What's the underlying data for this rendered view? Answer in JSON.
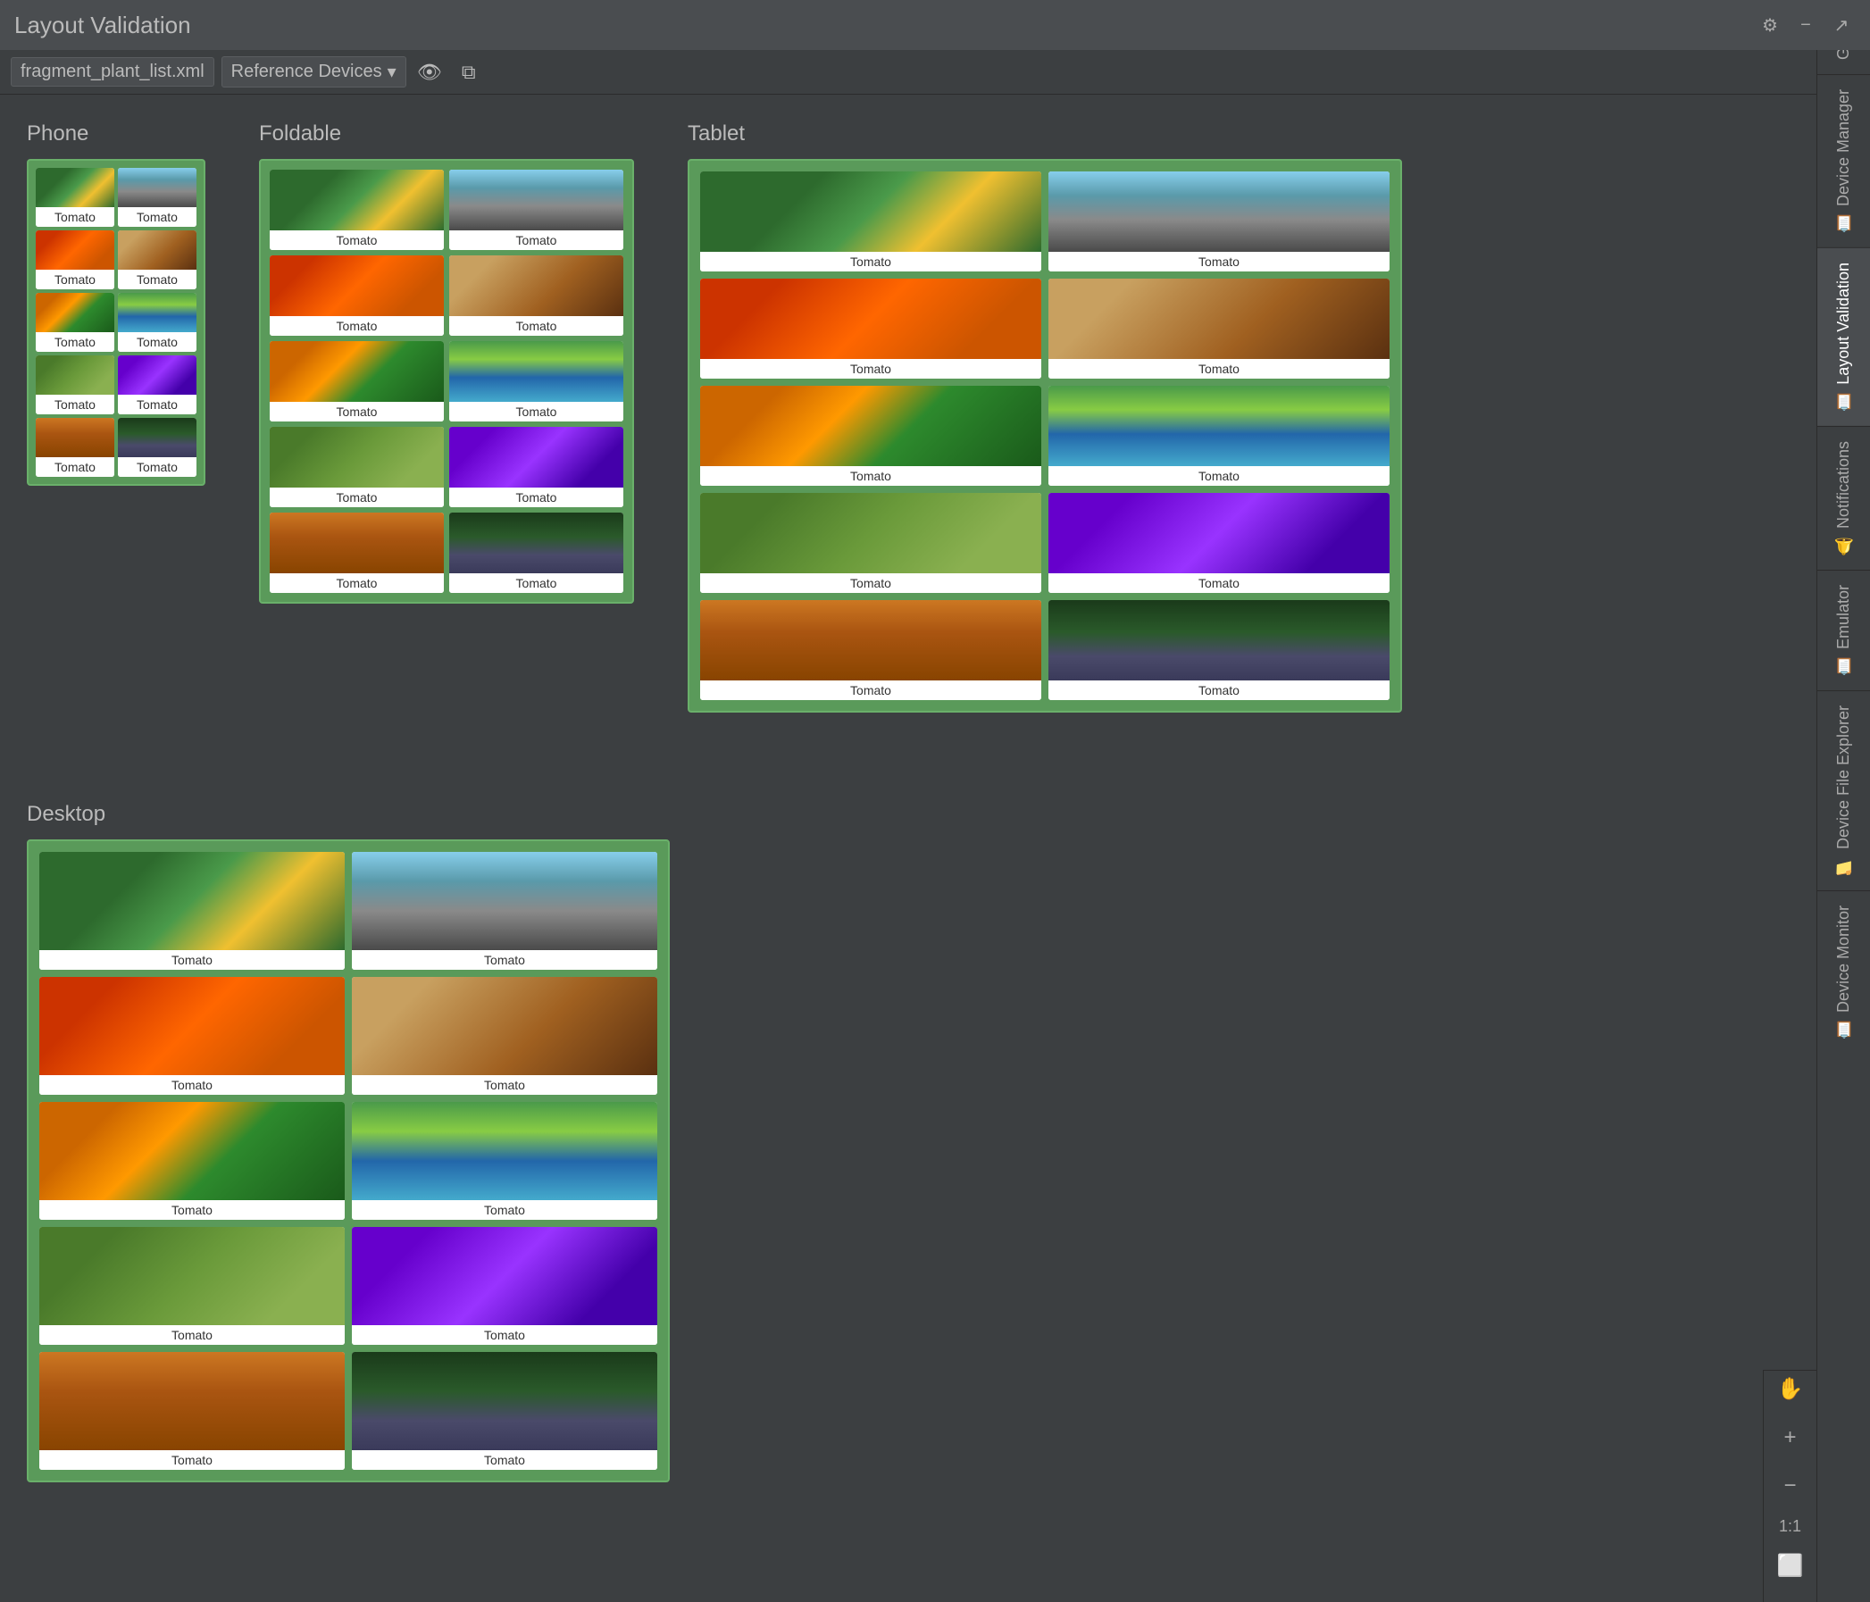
{
  "titleBar": {
    "title": "Layout Validation",
    "gearIcon": "⚙",
    "minusIcon": "−",
    "arrowIcon": "↗"
  },
  "toolbar": {
    "file": "fragment_plant_list.xml",
    "dropdown": "Reference Devices",
    "dropdownIcon": "▾",
    "eyeIcon": "👁",
    "copyIcon": "⧉"
  },
  "rightTabs": [
    {
      "id": "grade",
      "label": "Grade",
      "icon": "≡"
    },
    {
      "id": "device-manager",
      "label": "Device Manager",
      "icon": "📋"
    },
    {
      "id": "layout-validation",
      "label": "Layout Validation",
      "icon": "📋",
      "active": true
    },
    {
      "id": "notifications",
      "label": "Notifications",
      "icon": "🔔"
    },
    {
      "id": "emulator",
      "label": "Emulator",
      "icon": "📋"
    },
    {
      "id": "device-file-explorer",
      "label": "Device File Explorer",
      "icon": "📁"
    },
    {
      "id": "device-monitor",
      "label": "Device Monitor",
      "icon": "📋"
    }
  ],
  "devices": {
    "phone": {
      "title": "Phone",
      "cards": [
        {
          "label": "Tomato",
          "img": "butterfly"
        },
        {
          "label": "Tomato",
          "img": "cityscape"
        },
        {
          "label": "Tomato",
          "img": "autumn"
        },
        {
          "label": "Tomato",
          "img": "macro"
        },
        {
          "label": "Tomato",
          "img": "sunflower"
        },
        {
          "label": "Tomato",
          "img": "coastal"
        },
        {
          "label": "Tomato",
          "img": "vineyard"
        },
        {
          "label": "Tomato",
          "img": "purple"
        },
        {
          "label": "Tomato",
          "img": "desert"
        },
        {
          "label": "Tomato",
          "img": "forest"
        }
      ]
    },
    "foldable": {
      "title": "Foldable",
      "cards": [
        {
          "label": "Tomato",
          "img": "butterfly"
        },
        {
          "label": "Tomato",
          "img": "cityscape"
        },
        {
          "label": "Tomato",
          "img": "autumn"
        },
        {
          "label": "Tomato",
          "img": "macro"
        },
        {
          "label": "Tomato",
          "img": "sunflower"
        },
        {
          "label": "Tomato",
          "img": "coastal"
        },
        {
          "label": "Tomato",
          "img": "vineyard"
        },
        {
          "label": "Tomato",
          "img": "purple"
        },
        {
          "label": "Tomato",
          "img": "desert"
        },
        {
          "label": "Tomato",
          "img": "forest"
        }
      ]
    },
    "tablet": {
      "title": "Tablet",
      "cards": [
        {
          "label": "Tomato",
          "img": "butterfly"
        },
        {
          "label": "Tomato",
          "img": "cityscape"
        },
        {
          "label": "Tomato",
          "img": "autumn"
        },
        {
          "label": "Tomato",
          "img": "macro"
        },
        {
          "label": "Tomato",
          "img": "sunflower"
        },
        {
          "label": "Tomato",
          "img": "coastal"
        },
        {
          "label": "Tomato",
          "img": "vineyard"
        },
        {
          "label": "Tomato",
          "img": "purple"
        },
        {
          "label": "Tomato",
          "img": "desert"
        },
        {
          "label": "Tomato",
          "img": "forest"
        }
      ]
    },
    "desktop": {
      "title": "Desktop",
      "cards": [
        {
          "label": "Tomato",
          "img": "butterfly"
        },
        {
          "label": "Tomato",
          "img": "cityscape"
        },
        {
          "label": "Tomato",
          "img": "autumn"
        },
        {
          "label": "Tomato",
          "img": "macro"
        },
        {
          "label": "Tomato",
          "img": "sunflower"
        },
        {
          "label": "Tomato",
          "img": "coastal"
        },
        {
          "label": "Tomato",
          "img": "vineyard"
        },
        {
          "label": "Tomato",
          "img": "purple"
        },
        {
          "label": "Tomato",
          "img": "desert"
        },
        {
          "label": "Tomato",
          "img": "forest"
        }
      ]
    }
  },
  "bottomTools": {
    "handIcon": "✋",
    "plusIcon": "+",
    "minusIcon": "−",
    "zoomLabel": "1:1",
    "screenIcon": "⬜"
  }
}
